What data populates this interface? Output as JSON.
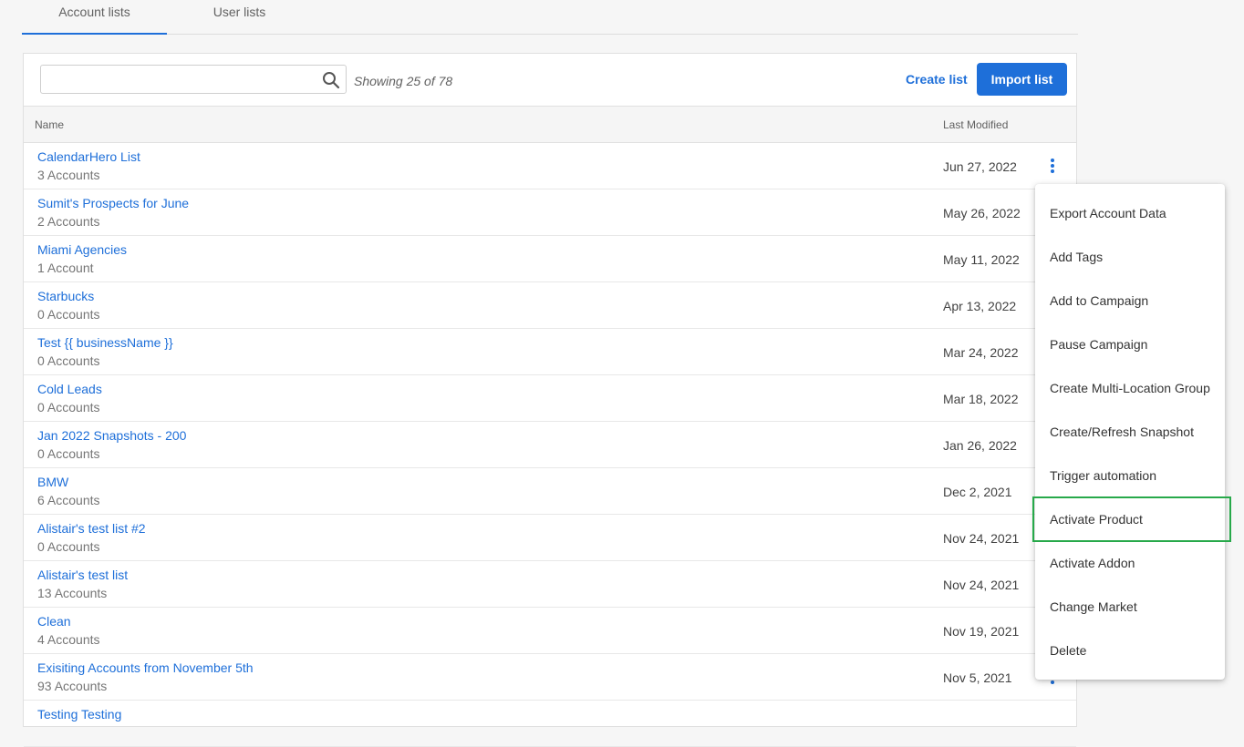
{
  "tabs": [
    {
      "label": "Account lists",
      "active": true
    },
    {
      "label": "User lists",
      "active": false
    }
  ],
  "toolbar": {
    "search_value": "",
    "search_placeholder": "",
    "showing_text": "Showing 25 of 78",
    "create_label": "Create list",
    "import_label": "Import list"
  },
  "table": {
    "headers": {
      "name": "Name",
      "modified": "Last Modified"
    },
    "rows": [
      {
        "name": "CalendarHero List",
        "count": "3 Accounts",
        "date": "Jun 27, 2022"
      },
      {
        "name": "Sumit's Prospects for June",
        "count": "2 Accounts",
        "date": "May 26, 2022"
      },
      {
        "name": "Miami Agencies",
        "count": "1 Account",
        "date": "May 11, 2022"
      },
      {
        "name": "Starbucks",
        "count": "0 Accounts",
        "date": "Apr 13, 2022"
      },
      {
        "name": "Test {{ businessName }}",
        "count": "0 Accounts",
        "date": "Mar 24, 2022"
      },
      {
        "name": "Cold Leads",
        "count": "0 Accounts",
        "date": "Mar 18, 2022"
      },
      {
        "name": "Jan 2022 Snapshots - 200",
        "count": "0 Accounts",
        "date": "Jan 26, 2022"
      },
      {
        "name": "BMW",
        "count": "6 Accounts",
        "date": "Dec 2, 2021"
      },
      {
        "name": "Alistair's test list #2",
        "count": "0 Accounts",
        "date": "Nov 24, 2021"
      },
      {
        "name": "Alistair's test list",
        "count": "13 Accounts",
        "date": "Nov 24, 2021"
      },
      {
        "name": "Clean",
        "count": "4 Accounts",
        "date": "Nov 19, 2021"
      },
      {
        "name": "Exisiting Accounts from November 5th",
        "count": "93 Accounts",
        "date": "Nov 5, 2021"
      },
      {
        "name": "Testing Testing",
        "count": "",
        "date": ""
      }
    ]
  },
  "menu": {
    "items": [
      "Export Account Data",
      "Add Tags",
      "Add to Campaign",
      "Pause Campaign",
      "Create Multi-Location Group",
      "Create/Refresh Snapshot",
      "Trigger automation",
      "Activate Product",
      "Activate Addon",
      "Change Market",
      "Delete"
    ],
    "highlighted_item": "Activate Product"
  },
  "colors": {
    "accent": "#1e6fd9",
    "highlight": "#27a94a"
  }
}
